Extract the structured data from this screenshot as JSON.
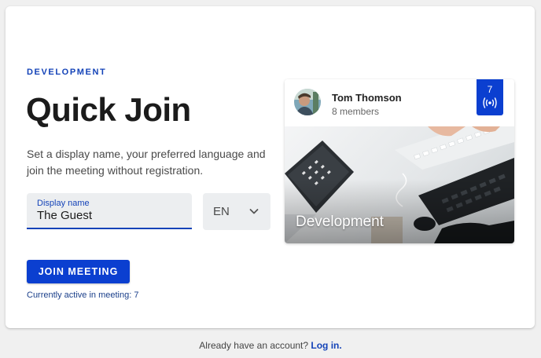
{
  "hero": {
    "eyebrow": "DEVELOPMENT",
    "title": "Quick Join",
    "description": "Set a display name, your preferred language and join the meeting without registration."
  },
  "form": {
    "display_name_label": "Display name",
    "display_name_value": "The Guest",
    "language_value": "EN",
    "join_label": "JOIN MEETING",
    "active_text": "Currently active in meeting: 7"
  },
  "meeting_card": {
    "host_name": "Tom Thomson",
    "members": "8 members",
    "live_count": "7",
    "image_title": "Development",
    "live_icon": "broadcast-icon"
  },
  "footer": {
    "prompt": "Already have an account?",
    "login_label": "Log in."
  },
  "colors": {
    "accent": "#0b3fd0",
    "eyebrow": "#1443b8",
    "background": "#f0f0f0"
  }
}
